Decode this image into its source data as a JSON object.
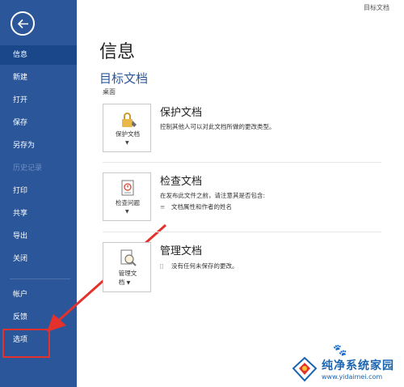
{
  "window_title": "目标文档",
  "sidebar": {
    "items": [
      {
        "label": "信息"
      },
      {
        "label": "新建"
      },
      {
        "label": "打开"
      },
      {
        "label": "保存"
      },
      {
        "label": "另存为"
      },
      {
        "label": "历史记录"
      },
      {
        "label": "打印"
      },
      {
        "label": "共享"
      },
      {
        "label": "导出"
      },
      {
        "label": "关闭"
      },
      {
        "label": "帐户"
      },
      {
        "label": "反馈"
      },
      {
        "label": "选项"
      }
    ],
    "active_item": "信息",
    "disabled_item": "历史记录"
  },
  "main": {
    "page_title": "信息",
    "doc_title": "目标文档",
    "doc_location": "桌面",
    "sections": [
      {
        "button_label": "保护文档",
        "title": "保护文档",
        "description": "控制其他人可以对此文档所做的更改类型。",
        "icon": "lock-icon"
      },
      {
        "button_label": "检查问题",
        "title": "检查文档",
        "description": "在发布此文件之前，请注意其是否包含:",
        "bullet": "文档属性和作者的姓名",
        "icon": "inspect-document-icon"
      },
      {
        "button_label_line1": "管理文",
        "button_label_line2": "档",
        "title": "管理文档",
        "description": "没有任何未保存的更改。",
        "icon": "manage-document-icon"
      }
    ]
  },
  "watermark": {
    "name": "纯净系统家园",
    "url": "www.yidaimei.com"
  },
  "colors": {
    "sidebar_bg": "#2b579a",
    "sidebar_active": "#19478a",
    "annotation_red": "#e5312c",
    "doc_title_blue": "#2b579a"
  }
}
